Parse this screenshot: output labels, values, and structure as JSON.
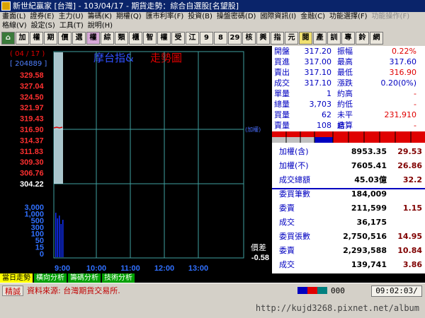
{
  "window": {
    "title": "新世紀贏家 [台灣] - 103/04/17 - 期貨走勢：綜合自選股[名望股]"
  },
  "menu": {
    "row1": [
      "畫面(L)",
      "證券(E)",
      "主力(U)",
      "籌碼(K)",
      "期權(Q)",
      "匯市利率(F)",
      "投資(B)",
      "操盤密碼(D)",
      "國際資訊(I)",
      "金融(C)",
      "功能選擇(F)",
      "功能操作(F)"
    ],
    "row1_disabled": [
      false,
      false,
      false,
      false,
      false,
      false,
      false,
      false,
      false,
      false,
      false,
      true
    ],
    "row2": [
      "格線(V)",
      "設定(S)",
      "工具(T)",
      "說明(H)"
    ]
  },
  "toolbar": [
    "⌂",
    "加",
    "權",
    "期",
    "價",
    "選",
    "權",
    "綜",
    "類",
    "櫃",
    "智",
    "權",
    "受",
    "江",
    "9",
    "8",
    "29",
    "核",
    "興",
    "指",
    "元",
    "閱",
    "產",
    "訓",
    "專",
    "鈴",
    "網"
  ],
  "chart": {
    "date_label": "( 04 / 17 )",
    "id_label": "[ 204889 ]",
    "title_name": "摩台指&",
    "title_kind": "走勢圖",
    "ref_label": "(加權)",
    "price_ticks": [
      "329.58",
      "327.04",
      "324.50",
      "321.97",
      "319.43",
      "316.90",
      "314.37",
      "311.83",
      "309.30",
      "306.76",
      "304.22"
    ],
    "price_tick_colors": [
      "#ff3030",
      "#ff3030",
      "#ff3030",
      "#ff3030",
      "#ff3030",
      "#ff3030",
      "#ff3030",
      "#ff3030",
      "#ff3030",
      "#ff3030",
      "#ffffff"
    ],
    "reference_price": "316.90",
    "volume_ticks": [
      "3,000",
      "1,000",
      "500",
      "300",
      "100",
      "50",
      "15",
      "0"
    ],
    "time_ticks": [
      "9:00",
      "10:00",
      "11:00",
      "12:00",
      "13:00"
    ],
    "price_diff_label": "價差",
    "price_diff_value": "-0.58"
  },
  "quote": {
    "rows": [
      {
        "l1": "開盤",
        "v1": "317.20",
        "l2": "振幅",
        "v2": "0.22%"
      },
      {
        "l1": "買進",
        "v1": "317.00",
        "l2": "最高",
        "v2": "317.60"
      },
      {
        "l1": "賣出",
        "v1": "317.10",
        "l2": "最低",
        "v2": "316.90"
      },
      {
        "l1": "成交",
        "v1": "317.10",
        "l2": "漲跌",
        "v2": "0.20(0%)"
      },
      {
        "l1": "單量",
        "v1": "1",
        "l2": "約高",
        "v2": "-"
      },
      {
        "l1": "總量",
        "v1": "3,703",
        "l2": "約低",
        "v2": "-"
      },
      {
        "l1": "買量",
        "v1": "62",
        "l2": "未平倉",
        "v2": "231,910"
      },
      {
        "l1": "賣量",
        "v1": "108",
        "l2": "結算",
        "v2": "-"
      }
    ]
  },
  "index_section": [
    {
      "label": "加權(含)",
      "value": "8953.35",
      "extra": "29.53"
    },
    {
      "label": "加權(不)",
      "value": "7605.41",
      "extra": "26.86"
    },
    {
      "label": "成交總額",
      "value": "45.03億",
      "extra": "32.2"
    }
  ],
  "order_section": [
    {
      "label": "委買筆數",
      "value": "184,009",
      "extra": ""
    },
    {
      "label": "委賣",
      "value": "211,599",
      "extra": "1.15"
    },
    {
      "label": "成交",
      "value": "36,175",
      "extra": ""
    },
    {
      "label": "委買張數",
      "value": "2,750,516",
      "extra": "14.95"
    },
    {
      "label": "委賣",
      "value": "2,293,588",
      "extra": "10.84"
    },
    {
      "label": "成交",
      "value": "139,741",
      "extra": "3.86"
    }
  ],
  "tabs": [
    "當日走勢",
    "橫向分析",
    "籌碼分析",
    "技術分析"
  ],
  "status": {
    "label": "精誠",
    "source": "資料來源: 台灣期貨交易所.",
    "counter": "000",
    "clock": "09:02:03/"
  },
  "watermark": "http://kujd3268.pixnet.net/album",
  "colors": {
    "up": "#e00000",
    "down": "#0000c0",
    "grid": "#3fa0a0"
  }
}
